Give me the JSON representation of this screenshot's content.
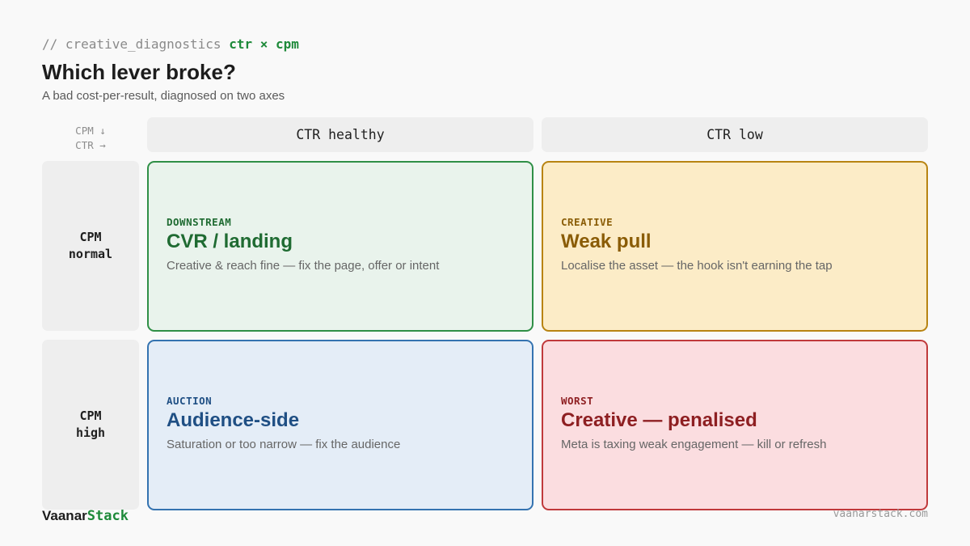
{
  "header": {
    "kicker_prefix": "// creative_diagnostics",
    "kicker_accent": "ctr × cpm",
    "title": "Which lever broke?",
    "subtitle": "A bad cost-per-result, diagnosed on two axes"
  },
  "axis_key": {
    "line1": "CPM ↓",
    "line2": "CTR →"
  },
  "columns": [
    "CTR healthy",
    "CTR low"
  ],
  "rows": [
    {
      "line1": "CPM",
      "line2": "normal"
    },
    {
      "line1": "CPM",
      "line2": "high"
    }
  ],
  "cells": [
    {
      "tag": "DOWNSTREAM",
      "name": "CVR / landing",
      "desc": "Creative & reach fine — fix the page, offer or intent",
      "color": "#2f8f46"
    },
    {
      "tag": "CREATIVE",
      "name": "Weak pull",
      "desc": "Localise the asset — the hook isn't earning the tap",
      "color": "#b88412"
    },
    {
      "tag": "AUCTION",
      "name": "Audience-side",
      "desc": "Saturation or too narrow — fix the audience",
      "color": "#3473b0"
    },
    {
      "tag": "WORST",
      "name": "Creative — penalised",
      "desc": "Meta is taxing weak engagement — kill or refresh",
      "color": "#c0393b"
    }
  ],
  "footer": {
    "brand_part1": "Vaanar",
    "brand_part2": "Stack",
    "site": "vaanarstack.com"
  }
}
